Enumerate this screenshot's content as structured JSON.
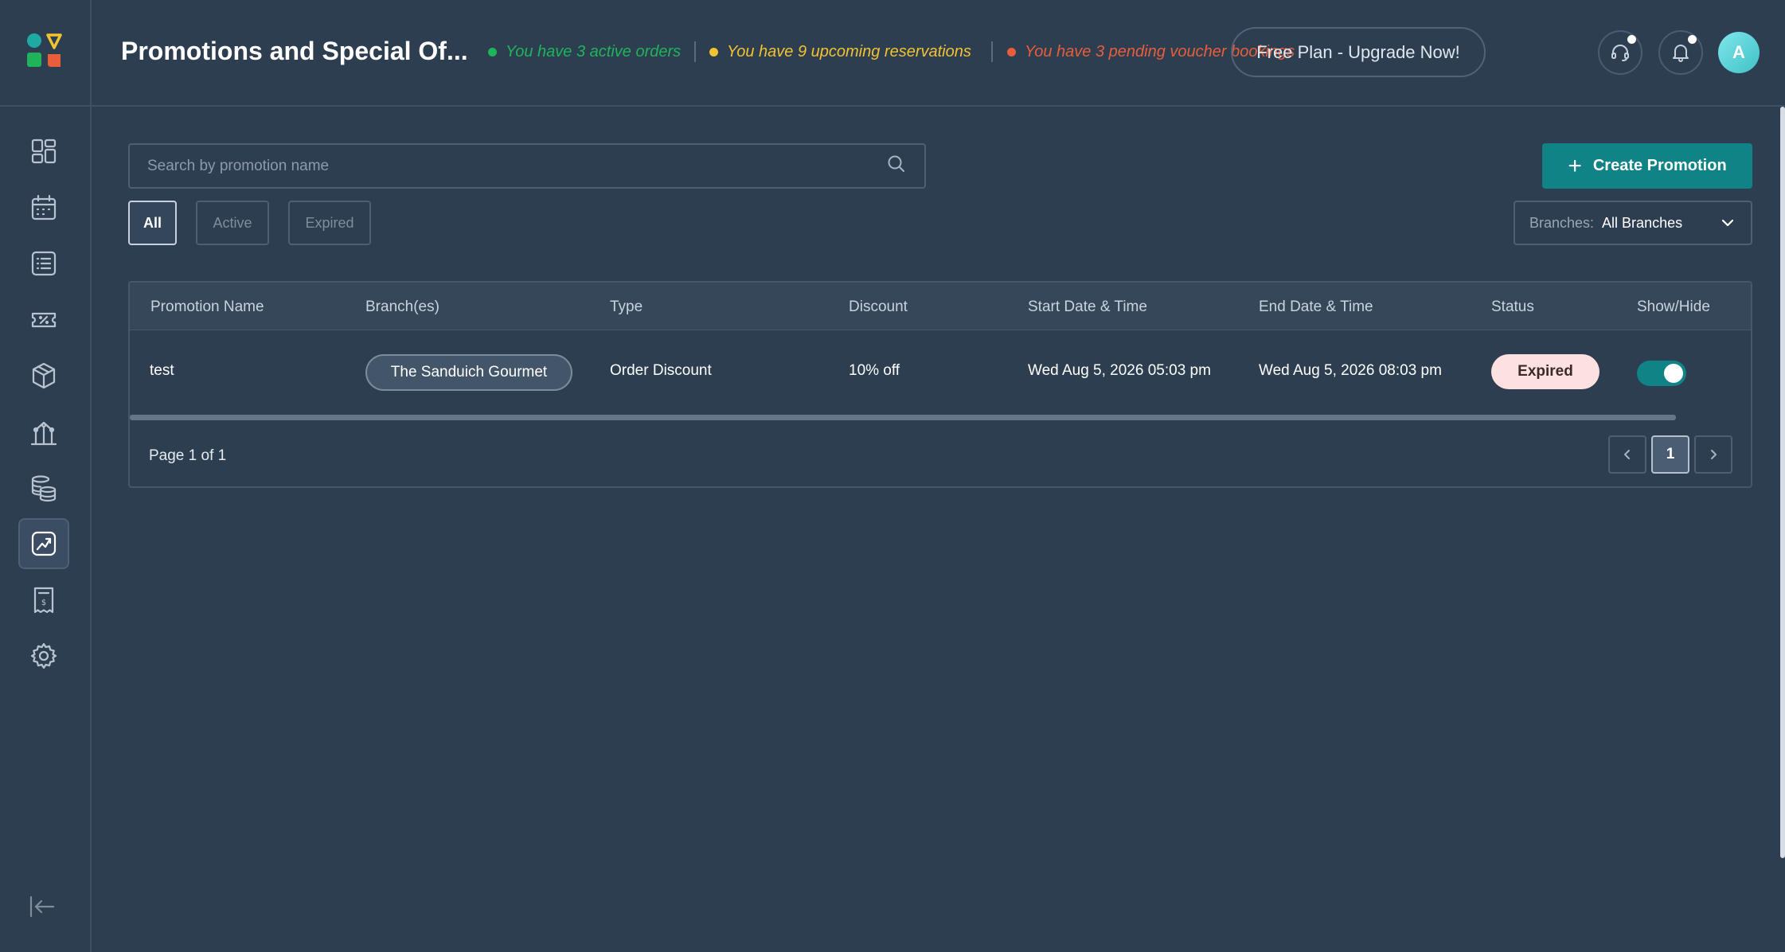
{
  "header": {
    "title": "Promotions and Special Of...",
    "statuses": [
      {
        "text": "You have 3 active orders",
        "color": "#1fb35a"
      },
      {
        "text": "You have 9 upcoming reservations",
        "color": "#f2c230"
      },
      {
        "text": "You have 3 pending voucher bookings",
        "color": "#e85d3a"
      }
    ],
    "upgrade_label": "Free Plan - Upgrade Now!",
    "support_icon": "headset-icon",
    "notification_icon": "bell-icon",
    "avatar_initial": "A"
  },
  "sidebar": {
    "items": [
      {
        "icon": "dashboard-icon",
        "active": false
      },
      {
        "icon": "calendar-icon",
        "active": false
      },
      {
        "icon": "orders-list-icon",
        "active": false
      },
      {
        "icon": "voucher-icon",
        "active": false
      },
      {
        "icon": "box-icon",
        "active": false
      },
      {
        "icon": "analytics-icon",
        "active": false
      },
      {
        "icon": "database-icon",
        "active": false
      },
      {
        "icon": "promotions-icon",
        "active": true
      },
      {
        "icon": "receipt-icon",
        "active": false
      },
      {
        "icon": "settings-icon",
        "active": false
      }
    ],
    "logout_icon": "logout-icon"
  },
  "toolbar": {
    "search_placeholder": "Search by promotion name",
    "search_value": "",
    "create_label": "Create Promotion",
    "filters": [
      "All",
      "Active",
      "Expired"
    ],
    "active_filter": "All",
    "branches_label": "Branches:",
    "branches_value": "All Branches"
  },
  "table": {
    "columns": [
      "Promotion Name",
      "Branch(es)",
      "Type",
      "Discount",
      "Start Date & Time",
      "End Date & Time",
      "Status",
      "Show/Hide"
    ],
    "rows": [
      {
        "name": "test",
        "branch": "The Sanduich Gourmet",
        "type": "Order Discount",
        "discount": "10% off",
        "start": "Wed Aug 5, 2026 05:03 pm",
        "end": "Wed Aug 5, 2026 08:03 pm",
        "status": "Expired",
        "visible": true
      }
    ]
  },
  "pagination": {
    "info": "Page 1 of 1",
    "current": "1"
  },
  "colors": {
    "accent": "#0f8386",
    "background": "#2c3e50",
    "expired_badge": "#fde0e0"
  }
}
